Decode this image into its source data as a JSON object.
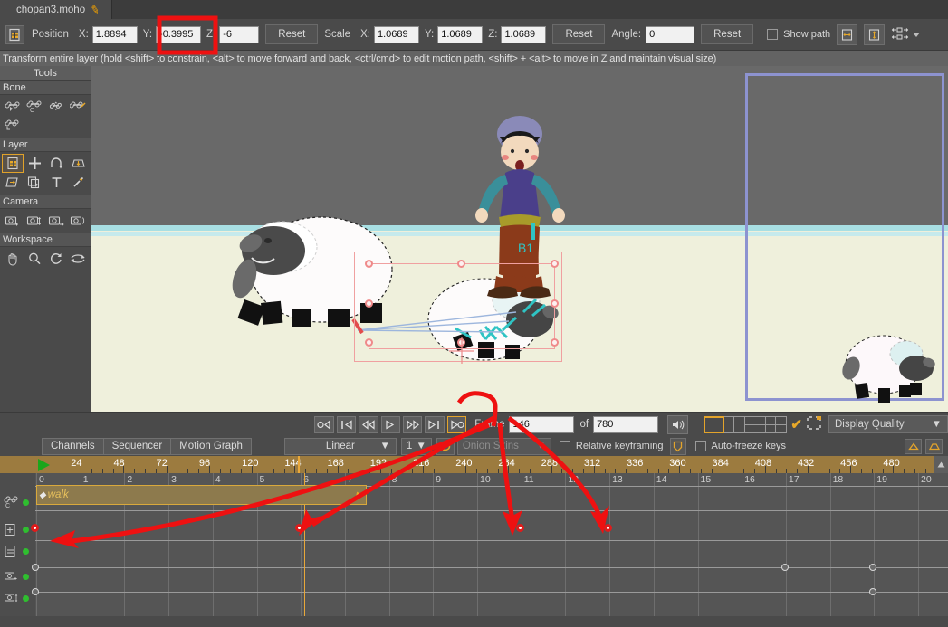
{
  "window": {
    "tab_title": "chopan3.moho",
    "tab_modified_glyph": "✎"
  },
  "toolbar": {
    "layer_icon": "layer-transform-icon",
    "position_label": "Position",
    "x_label": "X:",
    "y_label": "Y:",
    "z_label": "Z:",
    "position_x": "1.8894",
    "position_y": "-0.3995",
    "position_z": "-6",
    "reset_position": "Reset",
    "scale_label": "Scale",
    "scale_x": "1.0689",
    "scale_y": "1.0689",
    "scale_z": "1.0689",
    "reset_scale": "Reset",
    "angle_label": "Angle:",
    "angle_value": "0",
    "reset_angle": "Reset",
    "show_path_label": "Show path",
    "flip_h_icon": "flip-horizontal-icon",
    "flip_v_icon": "flip-vertical-icon",
    "transform_icon": "transform-options-icon"
  },
  "status": {
    "hint": "Transform entire layer (hold <shift> to constrain, <alt> to move forward and back, <ctrl/cmd> to edit motion path, <shift> + <alt> to move in Z and maintain visual size)"
  },
  "palette": {
    "title": "Tools",
    "groups": [
      {
        "name": "Bone",
        "tools": [
          {
            "name": "bone-select-icon",
            "selected": false
          },
          {
            "name": "bone-manipulate-icon",
            "selected": false
          },
          {
            "name": "bone-translate-icon",
            "selected": false
          },
          {
            "name": "bone-add-icon",
            "selected": false
          },
          {
            "name": "bone-offset-icon",
            "selected": false
          }
        ]
      },
      {
        "name": "Layer",
        "tools": [
          {
            "name": "layer-transform-icon",
            "selected": true
          },
          {
            "name": "layer-move-icon",
            "selected": false
          },
          {
            "name": "layer-rotate-icon",
            "selected": false
          },
          {
            "name": "layer-shear-icon",
            "selected": false
          },
          {
            "name": "layer-flip-icon",
            "selected": false
          },
          {
            "name": "layer-select-icon",
            "selected": false
          },
          {
            "name": "text-tool-icon",
            "selected": false
          },
          {
            "name": "eyedropper-icon",
            "selected": false
          }
        ]
      },
      {
        "name": "Camera",
        "tools": [
          {
            "name": "camera-track-icon",
            "selected": false
          },
          {
            "name": "camera-zoom-icon",
            "selected": false
          },
          {
            "name": "camera-roll-icon",
            "selected": false
          },
          {
            "name": "camera-pan-tilt-icon",
            "selected": false
          }
        ]
      },
      {
        "name": "Workspace",
        "tools": [
          {
            "name": "hand-pan-icon",
            "selected": false
          },
          {
            "name": "magnifier-zoom-icon",
            "selected": false
          },
          {
            "name": "rotate-workspace-icon",
            "selected": false
          },
          {
            "name": "reset-workspace-icon",
            "selected": false
          }
        ]
      }
    ]
  },
  "canvas": {
    "bone_label": "B1",
    "sky_color": "#696969",
    "ground_color": "#eff0dc",
    "horizon_color": "#a8dfe3",
    "camera_frame_color": "#8d93d0",
    "selection_color": "#f0a0a0",
    "bone_color": "#2fc4c4"
  },
  "playback": {
    "buttons": [
      {
        "name": "rewind-to-start-button",
        "glyph": "o◁"
      },
      {
        "name": "previous-keyframe-button",
        "glyph": "|◁"
      },
      {
        "name": "step-back-button",
        "glyph": "◁◁"
      },
      {
        "name": "play-button",
        "glyph": "▷"
      },
      {
        "name": "step-forward-button",
        "glyph": "▷▷"
      },
      {
        "name": "next-keyframe-button",
        "glyph": "▷|"
      },
      {
        "name": "loop-playback-button",
        "glyph": "▷o",
        "active": true
      }
    ],
    "frame_label": "Frame",
    "frame_value": "146",
    "of_label": "of",
    "total_frames": "780",
    "audio_icon": "speaker-icon",
    "layout_icons": [
      "single-view-icon",
      "two-pane-icon",
      "three-pane-icon",
      "four-pane-icon"
    ],
    "check_icon": "checkmark-icon",
    "select_icon": "marquee-select-icon",
    "display_quality": "Display Quality",
    "display_quality_caret": "▼"
  },
  "channels": {
    "tabs": [
      "Channels",
      "Sequencer",
      "Motion Graph"
    ],
    "interpolation": "Linear",
    "interpolation_caret": "▼",
    "frame_step": "1",
    "frame_step_caret": "▼",
    "onion_icon": "onion-skin-toggle-icon",
    "onion_skins": "Onion Skins",
    "onion_caret": "▼",
    "relative_keyframing": "Relative keyframing",
    "relative_icon": "relative-key-shield-icon",
    "auto_freeze_keys": "Auto-freeze keys",
    "scroll_up_icon": "scroll-up-icon",
    "scroll_home_icon": "scroll-home-icon"
  },
  "ruler": {
    "ticks": [
      24,
      48,
      72,
      96,
      120,
      144,
      168,
      192,
      216,
      240,
      264,
      288,
      312,
      336,
      360,
      384,
      408,
      432,
      456,
      480
    ],
    "playhead_frame": 146,
    "start_marker_icon": "playback-start-marker"
  },
  "timeline": {
    "column_labels": [
      0,
      1,
      2,
      3,
      4,
      5,
      6,
      7,
      8,
      9,
      10,
      11,
      12,
      13,
      14,
      15,
      16,
      17,
      18,
      19,
      20
    ],
    "action_name": "walk",
    "rows": [
      {
        "icon": "bone-channel-icon",
        "enabled": true
      },
      {
        "icon": "layer-transform-channel-icon",
        "enabled": true
      },
      {
        "icon": "layer-order-channel-icon",
        "enabled": true
      },
      {
        "icon": "camera-track-channel-icon",
        "enabled": true
      },
      {
        "icon": "camera-zoom-channel-icon",
        "enabled": true
      }
    ],
    "red_keyframes": [
      0,
      6,
      11,
      13
    ],
    "gray_keyframes_row1": [
      0,
      17,
      19
    ],
    "gray_keyframes_row2": [
      0,
      19
    ]
  },
  "annotations": {
    "highlight_field": "position_y",
    "highlight_button": "loop-playback-button",
    "arrow_count": 4,
    "color": "#ee1111"
  }
}
